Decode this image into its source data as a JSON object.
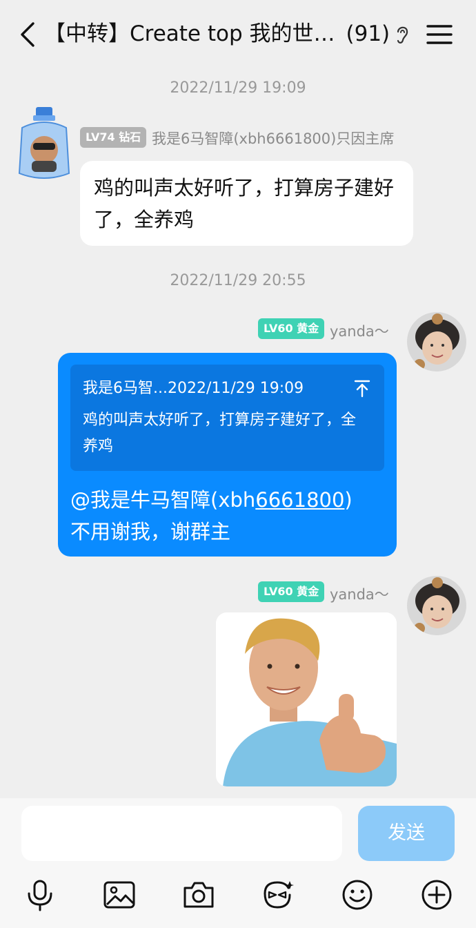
{
  "header": {
    "title": "【中转】Create top 我的世…",
    "member_count": "(91)"
  },
  "messages": [
    {
      "timestamp": "2022/11/29 19:09",
      "badge": "LV74 钻石",
      "badge_color": "#b3b3b3",
      "sender": "我是6马智障(xbh6661800)只因主席",
      "text": "鸡的叫声太好听了，打算房子建好了，全养鸡"
    },
    {
      "timestamp": "2022/11/29 20:55",
      "badge": "LV60 黄金",
      "badge_color": "#3fd2b4",
      "sender": "yanda～",
      "quote": {
        "header": "我是6马智...2022/11/29 19:09",
        "text": "鸡的叫声太好听了，打算房子建好了，全养鸡"
      },
      "reply_prefix": "@我是牛马智障(xbh",
      "reply_number": "6661800",
      "reply_suffix": ")",
      "reply_line2": "不用谢我，谢群主"
    },
    {
      "badge": "LV60 黄金",
      "badge_color": "#3fd2b4",
      "sender": "yanda～",
      "image": "thumbs-up-man-photo"
    }
  ],
  "composer": {
    "input_value": "",
    "send_label": "发送"
  },
  "toolbar": [
    "microphone-icon",
    "image-icon",
    "camera-icon",
    "sticker-face-icon",
    "emoji-icon",
    "plus-icon"
  ],
  "colors": {
    "accent": "#0a8bff",
    "quote_bg": "#0b77e0",
    "send_disabled": "#8ccaf9",
    "background": "#efefef"
  }
}
